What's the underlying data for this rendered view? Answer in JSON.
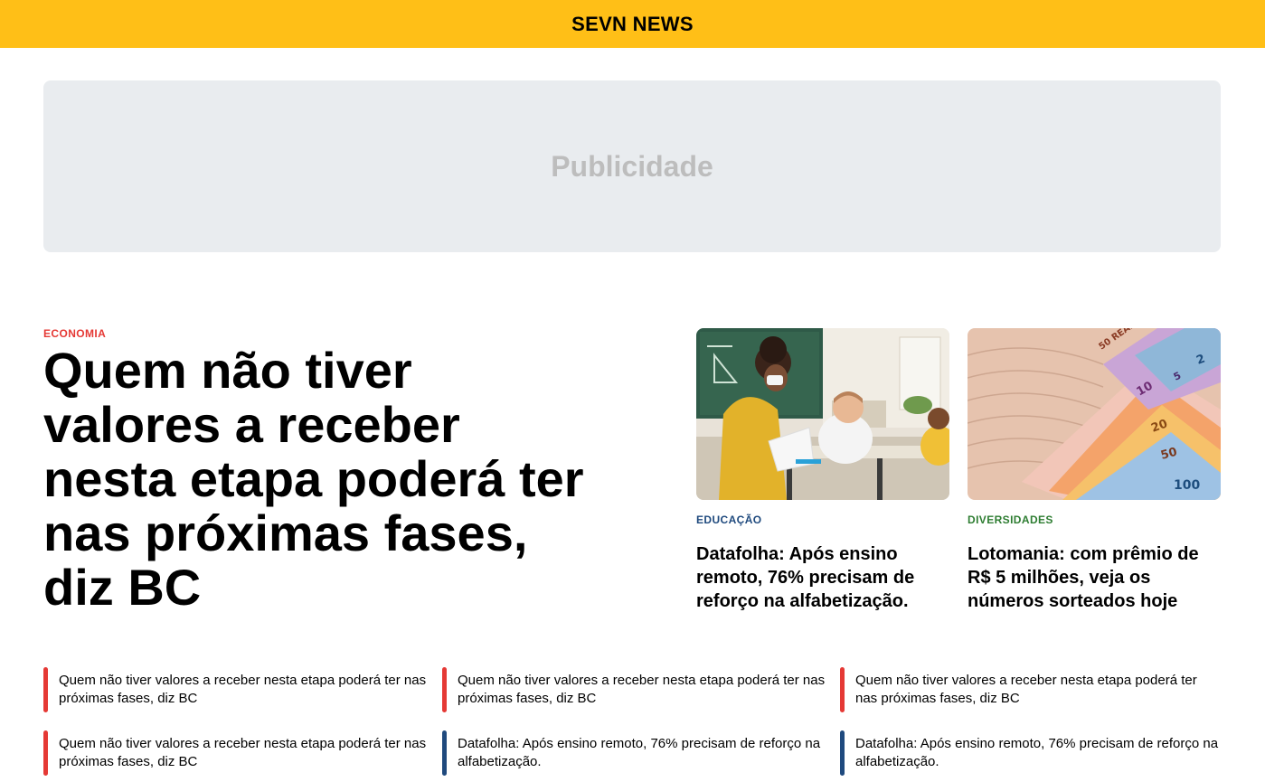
{
  "header": {
    "brand": "SEVN NEWS",
    "brand_color": "#ffbf17"
  },
  "ad": {
    "label": "Publicidade"
  },
  "hero": {
    "category": "ECONOMIA",
    "title": "Quem não tiver valores a receber nesta etapa poderá ter nas próximas fases, diz BC"
  },
  "cards": [
    {
      "category": "EDUCAÇÃO",
      "title": "Datafolha: Após ensino remoto, 76% precisam de reforço na alfabetização.",
      "image": "teacher-classroom-photo"
    },
    {
      "category": "DIVERSIDADES",
      "title": "Lotomania: com prêmio de R$ 5 milhões, veja os números sorteados hoje",
      "image": "brazilian-real-banknotes-photo"
    }
  ],
  "list": [
    {
      "text": "Quem não tiver valores a receber nesta etapa poderá ter nas próximas fases, diz BC",
      "color": "#e53935"
    },
    {
      "text": "Quem não tiver valores a receber nesta etapa poderá ter nas próximas fases, diz BC",
      "color": "#e53935"
    },
    {
      "text": "Quem não tiver valores a receber nesta etapa poderá ter nas próximas fases, diz BC",
      "color": "#e53935"
    },
    {
      "text": "Quem não tiver valores a receber nesta etapa poderá ter nas próximas fases, diz BC",
      "color": "#e53935"
    },
    {
      "text": "Datafolha: Após ensino remoto, 76% precisam de reforço na alfabetização.",
      "color": "#1f4a7e"
    },
    {
      "text": "Datafolha: Após ensino remoto, 76% precisam de reforço na alfabetização.",
      "color": "#1f4a7e"
    }
  ]
}
